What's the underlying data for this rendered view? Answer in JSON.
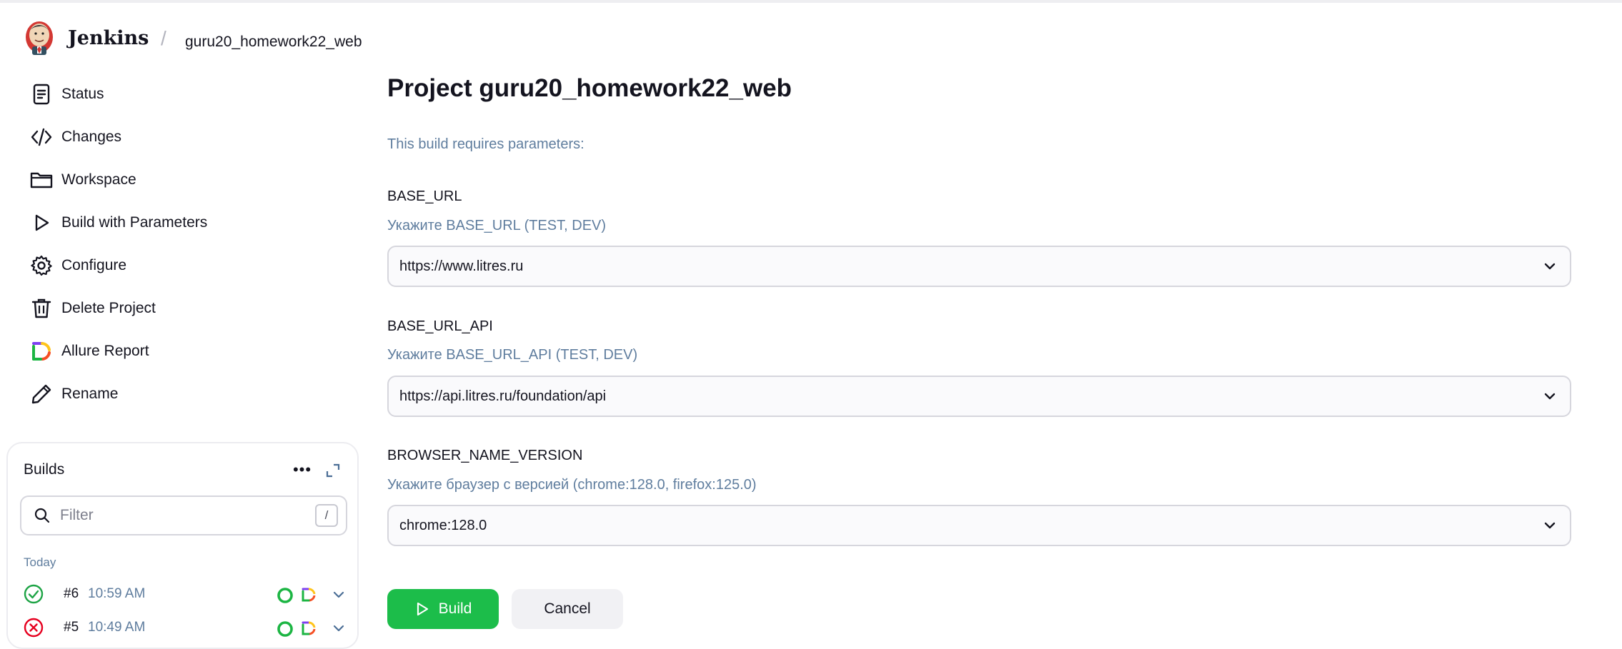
{
  "header": {
    "brand": "Jenkins",
    "breadcrumb_separator": "/",
    "breadcrumb_job": "guru20_homework22_web"
  },
  "sidebar": {
    "items": [
      {
        "label": "Status",
        "icon": "document-icon"
      },
      {
        "label": "Changes",
        "icon": "code-icon"
      },
      {
        "label": "Workspace",
        "icon": "folder-icon"
      },
      {
        "label": "Build with Parameters",
        "icon": "play-icon"
      },
      {
        "label": "Configure",
        "icon": "gear-icon"
      },
      {
        "label": "Delete Project",
        "icon": "trash-icon"
      },
      {
        "label": "Allure Report",
        "icon": "allure-icon"
      },
      {
        "label": "Rename",
        "icon": "pencil-icon"
      }
    ]
  },
  "builds": {
    "title": "Builds",
    "filter_placeholder": "Filter",
    "filter_shortcut": "/",
    "group_label": "Today",
    "rows": [
      {
        "number": "#6",
        "time": "10:59 AM",
        "status": "success",
        "status_color": "#1ea446"
      },
      {
        "number": "#5",
        "time": "10:49 AM",
        "status": "failed",
        "status_color": "#e6001f"
      }
    ]
  },
  "main": {
    "title": "Project guru20_homework22_web",
    "intro": "This build requires parameters:",
    "parameters": [
      {
        "name": "BASE_URL",
        "description": "Укажите BASE_URL (TEST, DEV)",
        "value": "https://www.litres.ru"
      },
      {
        "name": "BASE_URL_API",
        "description": "Укажите BASE_URL_API (TEST, DEV)",
        "value": "https://api.litres.ru/foundation/api"
      },
      {
        "name": "BROWSER_NAME_VERSION",
        "description": "Укажите браузер с версией (chrome:128.0, firefox:125.0)",
        "value": "chrome:128.0"
      }
    ],
    "build_label": "Build",
    "cancel_label": "Cancel"
  },
  "colors": {
    "accent_green": "#1cbd4a",
    "muted_blue": "#5f7d9e",
    "text": "#14141f"
  }
}
